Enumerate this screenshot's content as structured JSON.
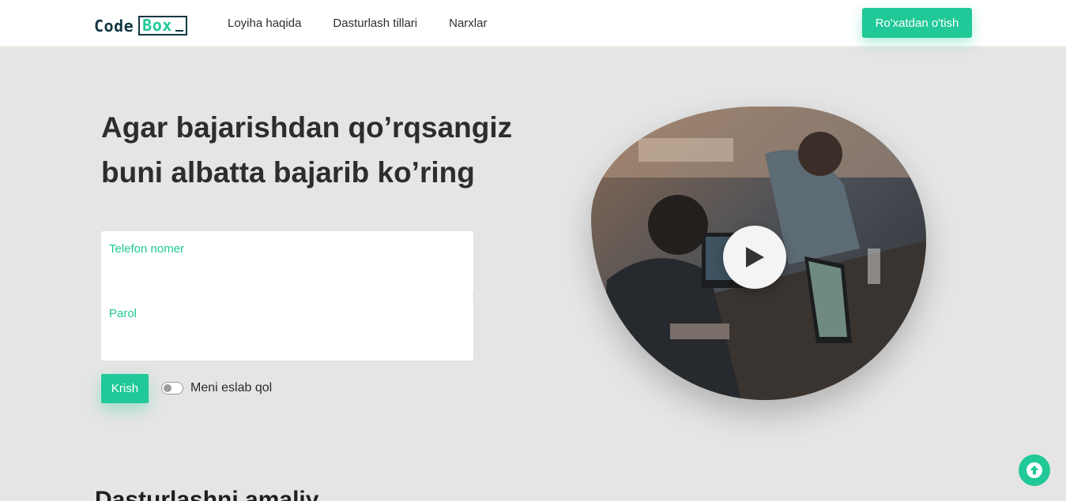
{
  "header": {
    "logo": {
      "part1": "Code",
      "part2": "Box"
    },
    "nav": [
      "Loyiha haqida",
      "Dasturlash tillari",
      "Narxlar"
    ],
    "signup_label": "Ro'xatdan o'tish"
  },
  "hero": {
    "title_line1": "Agar bajarishdan qo’rqsangiz",
    "title_line2": "buni albatta bajarib ko’ring"
  },
  "form": {
    "phone_label": "Telefon nomer",
    "password_label": "Parol",
    "login_label": "Krish",
    "remember_label": "Meni eslab qol"
  },
  "section": {
    "title": "Dasturlashni amaliy"
  },
  "colors": {
    "accent": "#20c997",
    "brand_dark": "#123744",
    "page_bg": "#e5e5e5"
  },
  "icons": {
    "play": "play-icon",
    "scroll_top": "arrow-up-circle-icon"
  }
}
